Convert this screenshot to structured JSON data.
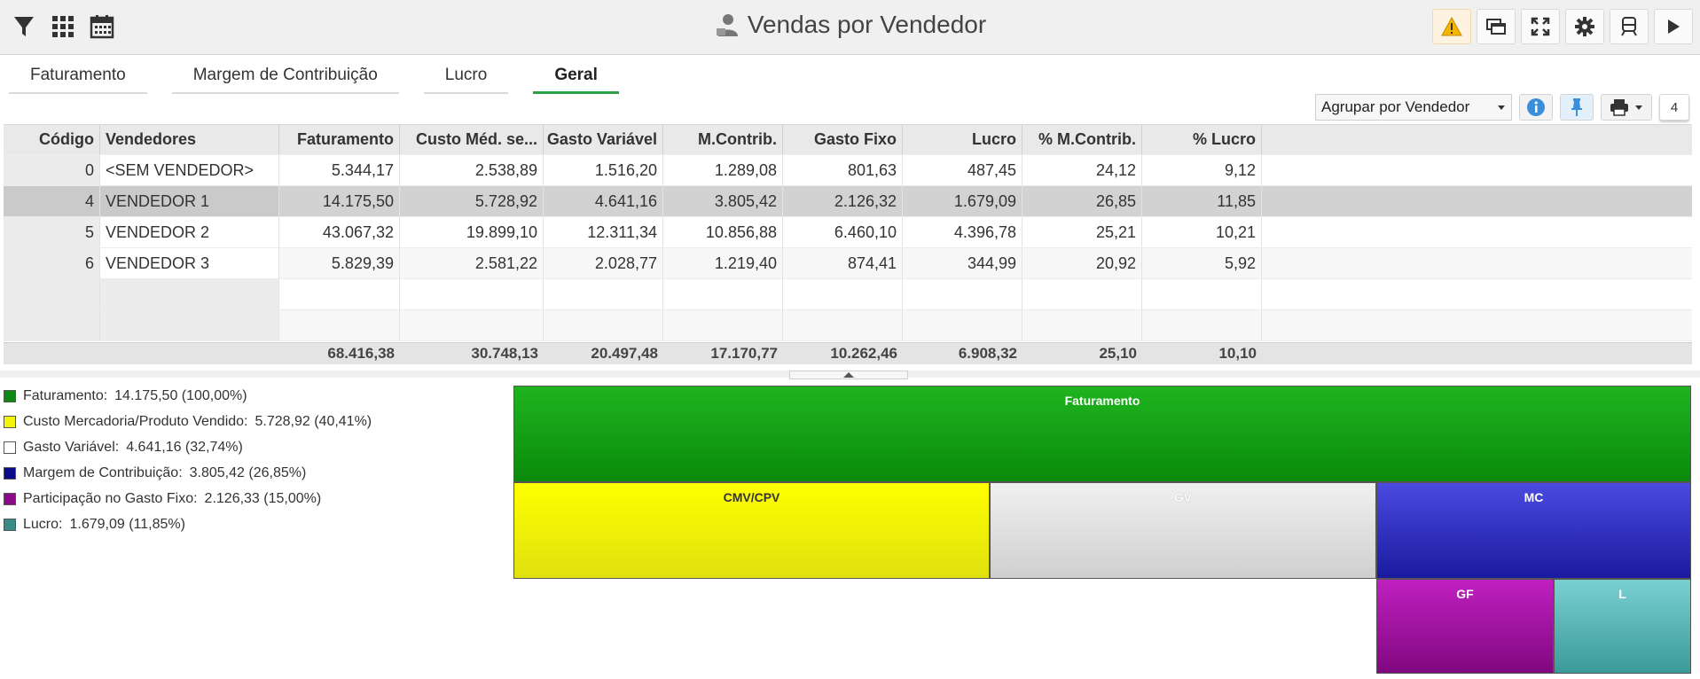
{
  "header": {
    "title": "Vendas por Vendedor",
    "left_icons": [
      "filter-icon",
      "grid-icon",
      "calendar-icon"
    ],
    "right_buttons": [
      "warning-icon",
      "windows-icon",
      "fullscreen-icon",
      "gear-icon",
      "train-icon",
      "play-icon"
    ]
  },
  "tabs": [
    {
      "label": "Faturamento",
      "active": false
    },
    {
      "label": "Margem de Contribuição",
      "active": false
    },
    {
      "label": "Lucro",
      "active": false
    },
    {
      "label": "Geral",
      "active": true
    }
  ],
  "toolbar": {
    "group_select": "Agrupar por Vendedor",
    "count": "4"
  },
  "table": {
    "columns": [
      "Código",
      "Vendedores",
      "Faturamento",
      "Custo Méd. se...",
      "Gasto Variável",
      "M.Contrib.",
      "Gasto Fixo",
      "Lucro",
      "% M.Contrib.",
      "% Lucro"
    ],
    "rows": [
      [
        "0",
        "<SEM VENDEDOR>",
        "5.344,17",
        "2.538,89",
        "1.516,20",
        "1.289,08",
        "801,63",
        "487,45",
        "24,12",
        "9,12"
      ],
      [
        "4",
        "VENDEDOR 1",
        "14.175,50",
        "5.728,92",
        "4.641,16",
        "3.805,42",
        "2.126,32",
        "1.679,09",
        "26,85",
        "11,85"
      ],
      [
        "5",
        "VENDEDOR 2",
        "43.067,32",
        "19.899,10",
        "12.311,34",
        "10.856,88",
        "6.460,10",
        "4.396,78",
        "25,21",
        "10,21"
      ],
      [
        "6",
        "VENDEDOR 3",
        "5.829,39",
        "2.581,22",
        "2.028,77",
        "1.219,40",
        "874,41",
        "344,99",
        "20,92",
        "5,92"
      ]
    ],
    "selected_row": 1,
    "totals": [
      "",
      "",
      "68.416,38",
      "30.748,13",
      "20.497,48",
      "17.170,77",
      "10.262,46",
      "6.908,32",
      "25,10",
      "10,10"
    ]
  },
  "legend": [
    {
      "label": "Faturamento:",
      "value": "14.175,50 (100,00%)",
      "color": "#0c8a12"
    },
    {
      "label": "Custo Mercadoria/Produto Vendido:",
      "value": "5.728,92 (40,41%)",
      "color": "#f4f40a"
    },
    {
      "label": "Gasto Variável:",
      "value": "4.641,16 (32,74%)",
      "color": "#ffffff"
    },
    {
      "label": "Margem de Contribuição:",
      "value": "3.805,42 (26,85%)",
      "color": "#0a0a8a"
    },
    {
      "label": "Participação no Gasto Fixo:",
      "value": "2.126,33 (15,00%)",
      "color": "#8a0a8a"
    },
    {
      "label": "Lucro:",
      "value": "1.679,09 (11,85%)",
      "color": "#3a8a8a"
    }
  ],
  "chart_data": {
    "type": "treemap",
    "nodes": [
      {
        "label": "Faturamento",
        "value": 14175.5
      },
      {
        "label": "CMV/CPV",
        "value": 5728.92
      },
      {
        "label": "GV",
        "value": 4641.16
      },
      {
        "label": "MC",
        "value": 3805.42
      },
      {
        "label": "GF",
        "value": 2126.33
      },
      {
        "label": "L",
        "value": 1679.09
      }
    ]
  }
}
